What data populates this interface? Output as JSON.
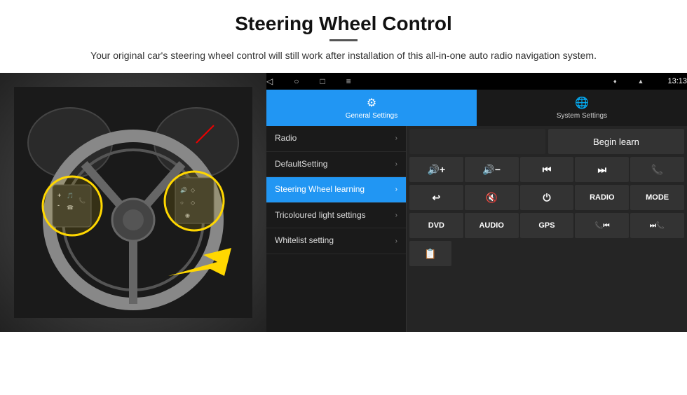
{
  "page": {
    "title": "Steering Wheel Control",
    "subtitle": "Your original car's steering wheel control will still work after installation of this all-in-one auto radio navigation system.",
    "divider": true
  },
  "status_bar": {
    "time": "13:13",
    "icons": [
      "location-icon",
      "signal-icon"
    ]
  },
  "nav_bar": {
    "buttons": [
      "back-icon",
      "home-icon",
      "square-icon",
      "menu-icon"
    ]
  },
  "tabs": [
    {
      "id": "general",
      "label": "General Settings",
      "icon": "⚙",
      "active": true
    },
    {
      "id": "system",
      "label": "System Settings",
      "icon": "🌐",
      "active": false
    }
  ],
  "menu_items": [
    {
      "id": "radio",
      "label": "Radio",
      "active": false
    },
    {
      "id": "default",
      "label": "DefaultSetting",
      "active": false
    },
    {
      "id": "steering",
      "label": "Steering Wheel learning",
      "active": true
    },
    {
      "id": "tricoloured",
      "label": "Tricoloured light settings",
      "active": false
    },
    {
      "id": "whitelist",
      "label": "Whitelist setting",
      "active": false
    }
  ],
  "right_panel": {
    "begin_learn_label": "Begin learn",
    "row1": [
      {
        "icon": "🔊+",
        "label": "vol-up"
      },
      {
        "icon": "🔊−",
        "label": "vol-down"
      },
      {
        "icon": "⏮",
        "label": "prev"
      },
      {
        "icon": "⏭",
        "label": "next"
      },
      {
        "icon": "📞",
        "label": "call"
      }
    ],
    "row2": [
      {
        "icon": "↩",
        "label": "answer"
      },
      {
        "icon": "🔇",
        "label": "mute"
      },
      {
        "icon": "⏻",
        "label": "power"
      },
      {
        "text": "RADIO",
        "label": "radio"
      },
      {
        "text": "MODE",
        "label": "mode"
      }
    ],
    "row3": [
      {
        "text": "DVD",
        "label": "dvd"
      },
      {
        "text": "AUDIO",
        "label": "audio"
      },
      {
        "text": "GPS",
        "label": "gps"
      },
      {
        "icon": "📞⏮",
        "label": "call-prev"
      },
      {
        "icon": "⏭📞",
        "label": "call-next"
      }
    ],
    "row4": [
      {
        "icon": "📋",
        "label": "list"
      }
    ]
  }
}
